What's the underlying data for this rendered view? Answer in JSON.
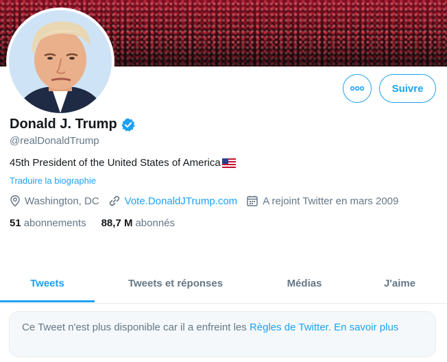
{
  "profile": {
    "name": "Donald J. Trump",
    "handle": "@realDonaldTrump",
    "bio": "45th President of the United States of America",
    "bio_emoji": "us-flag",
    "translate_label": "Traduire la biographie",
    "location": "Washington, DC",
    "website": "Vote.DonaldJTrump.com",
    "joined": "A rejoint Twitter en mars 2009",
    "verified": true
  },
  "actions": {
    "more_icon": "more-icon",
    "follow_label": "Suivre"
  },
  "stats": {
    "following_count": "51",
    "following_label": "abonnements",
    "followers_count": "88,7 M",
    "followers_label": "abonnés"
  },
  "tabs": [
    {
      "label": "Tweets",
      "active": true
    },
    {
      "label": "Tweets et réponses",
      "active": false
    },
    {
      "label": "Médias",
      "active": false
    },
    {
      "label": "J'aime",
      "active": false
    }
  ],
  "notice": {
    "text_before": "Ce Tweet n'est plus disponible car il a enfreint les ",
    "rules_link": "Règles de Twitter",
    "text_mid": ". ",
    "learn_more": "En savoir plus"
  },
  "colors": {
    "accent": "#1da1f2",
    "text": "#14171a",
    "secondary": "#657786"
  }
}
